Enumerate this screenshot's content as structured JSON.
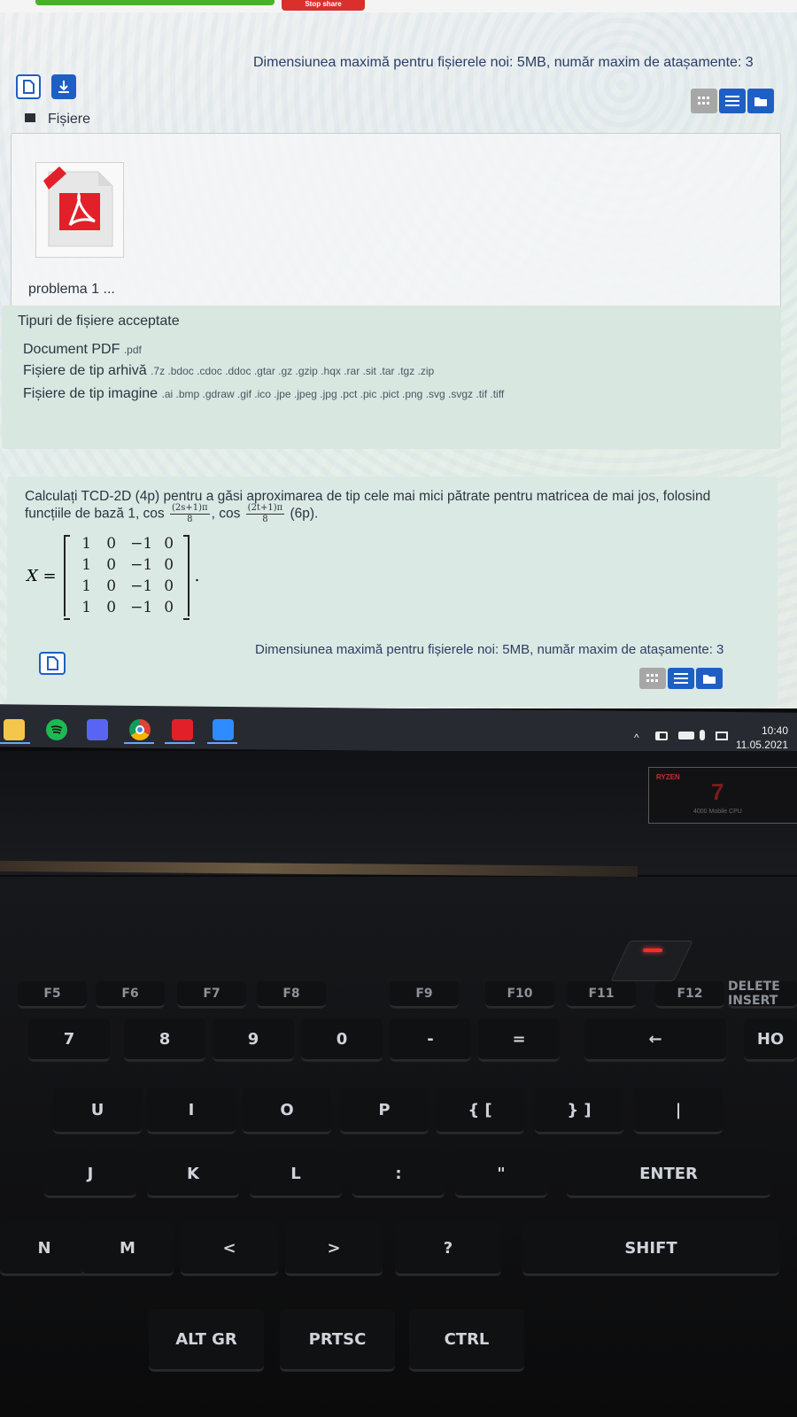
{
  "screen": {
    "top_button_label": "Stop share",
    "limit_text_top": "Dimensiunea maximă pentru fișierele noi: 5MB, număr maxim de atașamente: 3",
    "files_heading": "Fișiere",
    "file_name": "problema 1 ...",
    "accepted": {
      "title": "Tipuri de fișiere acceptate",
      "rows": [
        {
          "label": "Document PDF",
          "ext": ".pdf"
        },
        {
          "label": "Fișiere de tip arhivă",
          "ext": ".7z .bdoc .cdoc .ddoc .gtar .gz .gzip .hqx .rar .sit .tar .tgz .zip"
        },
        {
          "label": "Fișiere de tip imagine",
          "ext": ".ai .bmp .gdraw .gif .ico .jpe .jpeg .jpg .pct .pic .pict .png .svg .svgz .tif .tiff"
        }
      ]
    },
    "question": {
      "line1": "Calculați TCD-2D (4p) pentru a găsi aproximarea de tip cele mai mici pătrate pentru matricea de mai jos, folosind",
      "line2_prefix": "funcțiile de bază 1, cos",
      "frac1_num": "(2s+1)π",
      "frac1_den": "8",
      "sep": ", cos",
      "frac2_num": "(2t+1)π",
      "frac2_den": "8",
      "line2_suffix": "(6p).",
      "matrix_label": "X =",
      "matrix": [
        [
          "1",
          "0",
          "−1",
          "0"
        ],
        [
          "1",
          "0",
          "−1",
          "0"
        ],
        [
          "1",
          "0",
          "−1",
          "0"
        ],
        [
          "1",
          "0",
          "−1",
          "0"
        ]
      ],
      "matrix_end": "."
    },
    "limit_text_bottom": "Dimensiunea maximă pentru fișierele noi: 5MB, număr maxim de atașamente: 3"
  },
  "taskbar": {
    "time": "10:40",
    "date": "11.05.2021",
    "pinned": [
      "file-explorer",
      "spotify",
      "discord",
      "chrome",
      "acrobat",
      "zoom"
    ]
  },
  "laptop": {
    "sticker_brand": "RYZEN",
    "sticker_model": "7",
    "sticker_sub": "4000 Mobile CPU",
    "keys": {
      "fn_row": [
        "F5",
        "F6",
        "F7",
        "F8",
        "F9",
        "F10",
        "F11",
        "F12",
        "DELETE INSERT"
      ],
      "num_row": [
        "7",
        "8",
        "9",
        "0",
        "-",
        "=",
        "←",
        "HO"
      ],
      "row_u": [
        "U",
        "I",
        "O",
        "P",
        "{ [",
        "} ]",
        "|"
      ],
      "row_j": [
        "J",
        "K",
        "L",
        ":",
        "\"",
        "ENTER"
      ],
      "row_m": [
        "N",
        "M",
        "<",
        ">",
        "?",
        "SHIFT"
      ],
      "row_bottom": [
        "ALT GR",
        "PRTSC",
        "CTRL"
      ]
    }
  }
}
